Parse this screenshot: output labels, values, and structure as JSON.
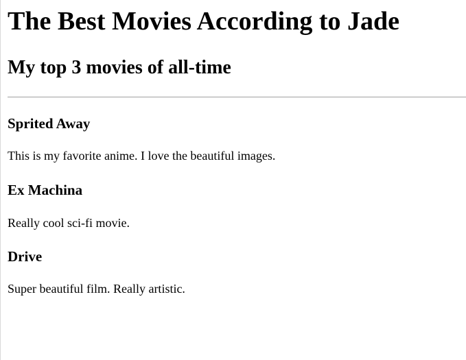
{
  "page": {
    "title": "The Best Movies According to Jade",
    "subtitle": "My top 3 movies of all-time"
  },
  "movies": [
    {
      "title": "Sprited Away",
      "description": "This is my favorite anime. I love the beautiful images."
    },
    {
      "title": "Ex Machina",
      "description": "Really cool sci-fi movie."
    },
    {
      "title": "Drive",
      "description": "Super beautiful film. Really artistic."
    }
  ],
  "colors": {
    "text": "#000000",
    "background": "#ffffff",
    "divider": "#9f9f9f"
  }
}
